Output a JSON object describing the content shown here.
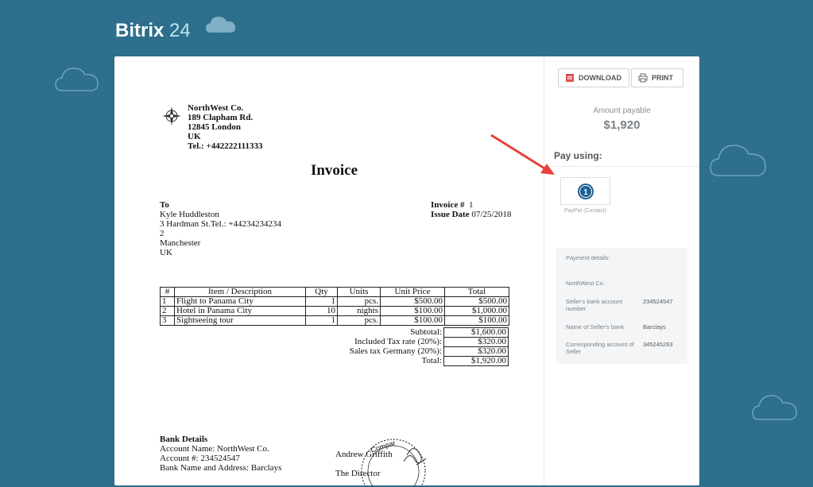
{
  "brand": {
    "name": "Bitrix",
    "number": "24"
  },
  "company": {
    "name": "NorthWest Co.",
    "street": "189 Clapham Rd.",
    "city": "12845 London",
    "country": "UK",
    "phone": "Tel.: +442222111333"
  },
  "invoice": {
    "title": "Invoice",
    "to_label": "To",
    "client_name": "Kyle Huddleston",
    "client_address": "3 Hardman St.Tel.: +44234234234",
    "client_line2": "2",
    "client_city": "Manchester",
    "client_country": "UK",
    "number_label": "Invoice #",
    "number": "1",
    "date_label": "Issue Date",
    "date": "07/25/2018"
  },
  "items_table": {
    "headers": [
      "#",
      "Item / Description",
      "Qty",
      "Units",
      "Unit Price",
      "Total"
    ],
    "rows": [
      [
        "1",
        "Flight to Panama City",
        "1",
        "pcs.",
        "$500.00",
        "$500.00"
      ],
      [
        "2",
        "Hotel in Panama City",
        "10",
        "nights",
        "$100.00",
        "$1,000.00"
      ],
      [
        "3",
        "Sightseeing tour",
        "1",
        "pcs.",
        "$100.00",
        "$100.00"
      ]
    ]
  },
  "totals": [
    {
      "label": "Subtotal:",
      "value": "$1,600.00",
      "boxed": true
    },
    {
      "label": "Included Tax rate (20%):",
      "value": "$320.00",
      "boxed": true
    },
    {
      "label": "Sales tax Germany (20%):",
      "value": "$320.00",
      "boxed": true
    },
    {
      "label": "Total:",
      "value": "$1,920.00",
      "boxed": true
    }
  ],
  "bank": {
    "title": "Bank Details",
    "account_name": "Account Name: NorthWest Co.",
    "account_no": "Account #: 234524547",
    "bank_name": "Bank Name and Address: Barclays"
  },
  "signature": {
    "name": "Andrew Griffith",
    "role": "The Director",
    "stamp_text": "Compar"
  },
  "sidebar": {
    "download_label": "DOWNLOAD",
    "print_label": "PRINT",
    "amount_label": "Amount payable",
    "amount": "$1,920",
    "pay_using": "Pay using:",
    "paypal_caption": "PayPal (Contact)",
    "details_title": "Payment details:",
    "details": [
      {
        "label": "NorthWest Co.",
        "value": ""
      },
      {
        "label": "Seller's bank account number",
        "value": "234524547"
      },
      {
        "label": "Name of Seller's bank",
        "value": "Barclays"
      },
      {
        "label": "Corresponding account of Seller",
        "value": "345245263"
      }
    ]
  },
  "colors": {
    "background": "#2d6f8c",
    "arrow": "#e8403a",
    "paypal_badge": "#1d5f92"
  }
}
